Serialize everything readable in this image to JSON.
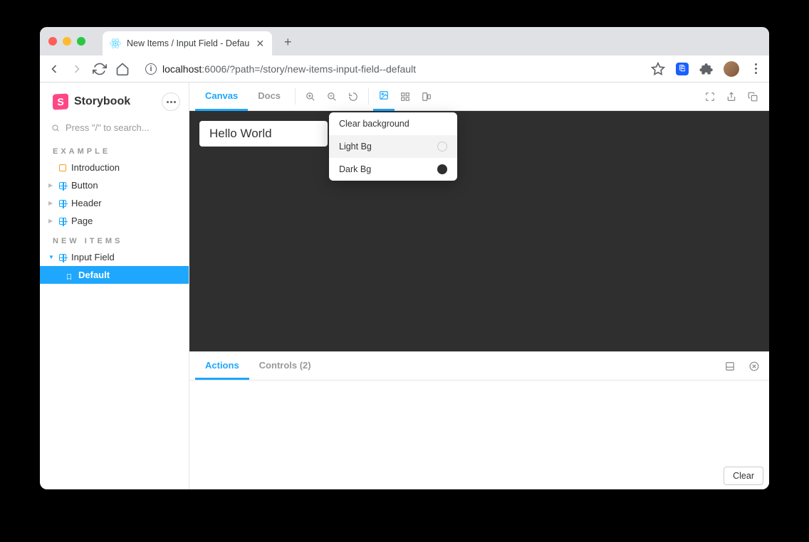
{
  "browser": {
    "tab_title": "New Items / Input Field - Defau",
    "url_host": "localhost",
    "url_port": ":6006",
    "url_path": "/?path=/story/new-items-input-field--default"
  },
  "sidebar": {
    "brand": "Storybook",
    "search_placeholder": "Press \"/\" to search...",
    "sections": [
      {
        "label": "EXAMPLE",
        "items": [
          {
            "label": "Introduction",
            "kind": "doc"
          },
          {
            "label": "Button",
            "kind": "component"
          },
          {
            "label": "Header",
            "kind": "component"
          },
          {
            "label": "Page",
            "kind": "component"
          }
        ]
      },
      {
        "label": "NEW ITEMS",
        "items": [
          {
            "label": "Input Field",
            "kind": "component",
            "expanded": true,
            "stories": [
              {
                "label": "Default",
                "selected": true
              }
            ]
          }
        ]
      }
    ]
  },
  "toolbar": {
    "tabs": {
      "canvas": "Canvas",
      "docs": "Docs"
    },
    "backgrounds_popover": {
      "clear": "Clear background",
      "options": [
        {
          "label": "Light Bg",
          "color": "#ffffff"
        },
        {
          "label": "Dark Bg",
          "color": "#2f2f2f"
        }
      ]
    }
  },
  "preview": {
    "input_value": "Hello World"
  },
  "addons": {
    "tabs": {
      "actions": "Actions",
      "controls": "Controls (2)"
    },
    "controls_count": 2,
    "clear_label": "Clear"
  },
  "colors": {
    "accent": "#1ea7fd",
    "storybook_pink": "#ff4785",
    "canvas_dark": "#2f2f2f"
  }
}
